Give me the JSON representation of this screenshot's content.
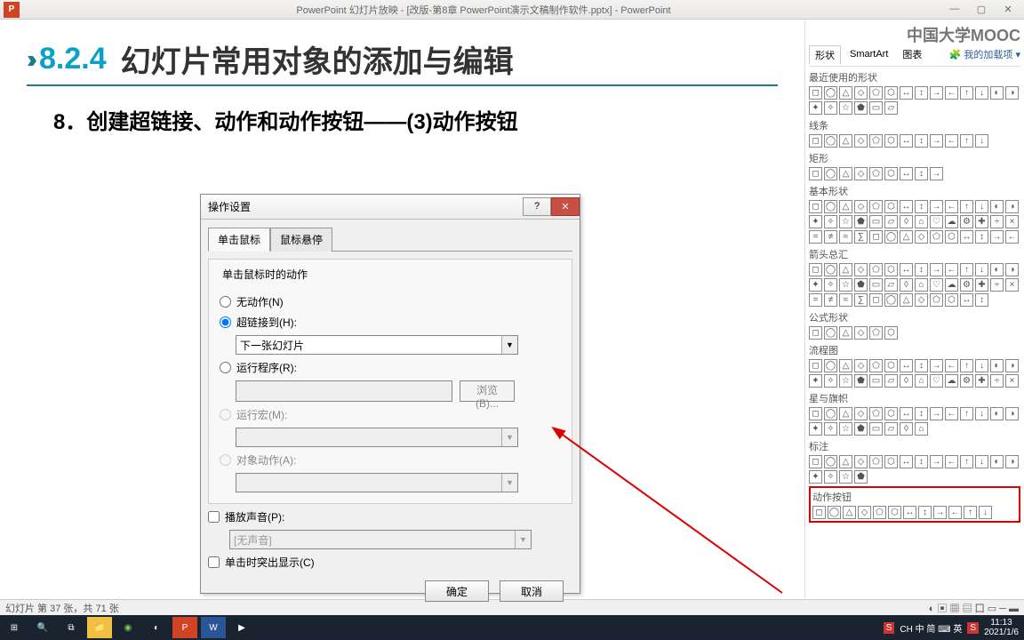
{
  "titlebar": {
    "app_short": "P",
    "title": "PowerPoint 幻灯片放映 - [改版-第8章 PowerPoint演示文稿制作软件.pptx] - PowerPoint",
    "min": "—",
    "max": "▢",
    "close": "✕"
  },
  "slide": {
    "section_num": "8.2.4",
    "section_title": "幻灯片常用对象的添加与编辑",
    "subhead": "8．创建超链接、动作和动作按钮——(3)动作按钮"
  },
  "dialog": {
    "title": "操作设置",
    "help": "?",
    "close": "✕",
    "tab_click": "单击鼠标",
    "tab_hover": "鼠标悬停",
    "group_title": "单击鼠标时的动作",
    "opt_none": "无动作(N)",
    "opt_hyperlink": "超链接到(H):",
    "hyperlink_value": "下一张幻灯片",
    "opt_run": "运行程序(R):",
    "browse": "浏览(B)...",
    "opt_macro": "运行宏(M):",
    "opt_objact": "对象动作(A):",
    "chk_sound": "播放声音(P):",
    "sound_value": "[无声音]",
    "chk_highlight": "单击时突出显示(C)",
    "ok": "确定",
    "cancel": "取消"
  },
  "shapes": {
    "watermark": "中国大学MOOC",
    "tab_shape": "形状",
    "tab_smartart": "SmartArt",
    "tab_chart": "图表",
    "addins": "我的加载项",
    "cat_recent": "最近使用的形状",
    "cat_lines": "线条",
    "cat_rects": "矩形",
    "cat_basic": "基本形状",
    "cat_arrows": "箭头总汇",
    "cat_eq": "公式形状",
    "cat_flow": "流程图",
    "cat_stars": "星与旗帜",
    "cat_callouts": "标注",
    "cat_action": "动作按钮"
  },
  "status": {
    "left": "幻灯片 第 37 张，共 71 张"
  },
  "taskbar": {
    "ime": "CH 中 简 ⌨ 英",
    "time": "11:13",
    "date": "2021/1/6"
  }
}
